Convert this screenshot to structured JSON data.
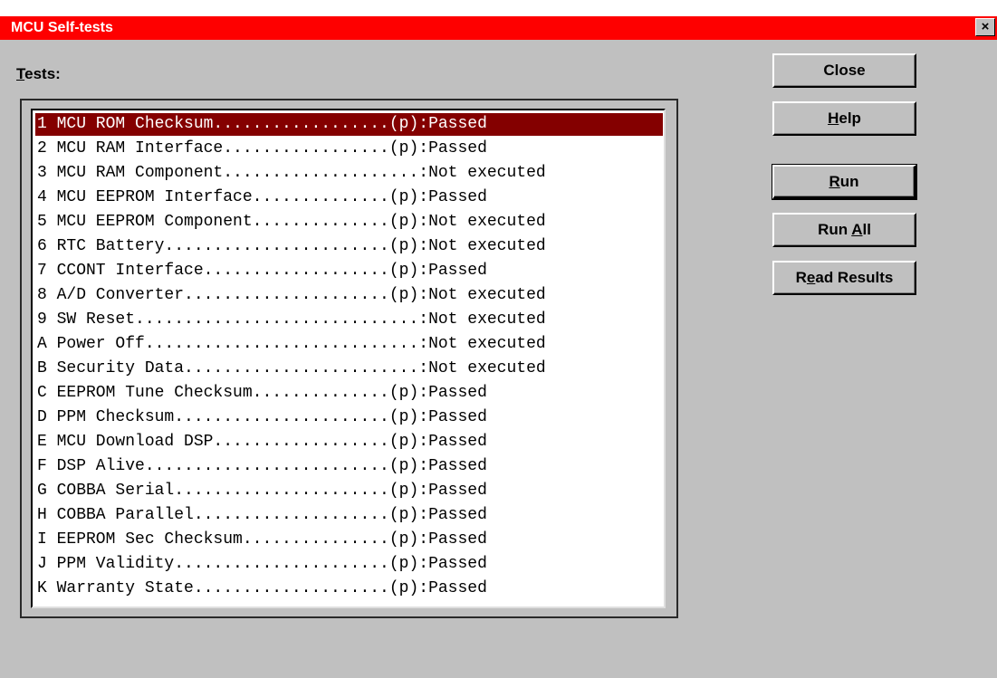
{
  "window": {
    "title": "MCU Self-tests",
    "close_glyph": "×",
    "titlebar_color": "#fe0000"
  },
  "tests_label": {
    "mnemonic": "T",
    "rest": "ests:"
  },
  "tests": [
    {
      "text": "1 MCU ROM Checksum..................(p):Passed",
      "selected": true
    },
    {
      "text": "2 MCU RAM Interface.................(p):Passed"
    },
    {
      "text": "3 MCU RAM Component....................:Not executed"
    },
    {
      "text": "4 MCU EEPROM Interface..............(p):Passed"
    },
    {
      "text": "5 MCU EEPROM Component..............(p):Not executed"
    },
    {
      "text": "6 RTC Battery.......................(p):Not executed"
    },
    {
      "text": "7 CCONT Interface...................(p):Passed"
    },
    {
      "text": "8 A/D Converter.....................(p):Not executed"
    },
    {
      "text": "9 SW Reset.............................:Not executed"
    },
    {
      "text": "A Power Off............................:Not executed"
    },
    {
      "text": "B Security Data........................:Not executed"
    },
    {
      "text": "C EEPROM Tune Checksum..............(p):Passed"
    },
    {
      "text": "D PPM Checksum......................(p):Passed"
    },
    {
      "text": "E MCU Download DSP..................(p):Passed"
    },
    {
      "text": "F DSP Alive.........................(p):Passed"
    },
    {
      "text": "G COBBA Serial......................(p):Passed"
    },
    {
      "text": "H COBBA Parallel....................(p):Passed"
    },
    {
      "text": "I EEPROM Sec Checksum...............(p):Passed"
    },
    {
      "text": "J PPM Validity......................(p):Passed"
    },
    {
      "text": "K Warranty State....................(p):Passed"
    }
  ],
  "buttons": {
    "close": {
      "label": "Close"
    },
    "help": {
      "pre": "",
      "mnemonic": "H",
      "post": "elp"
    },
    "run": {
      "pre": "",
      "mnemonic": "R",
      "post": "un"
    },
    "run_all": {
      "pre": "Run ",
      "mnemonic": "A",
      "post": "ll"
    },
    "read_results": {
      "pre": "R",
      "mnemonic": "e",
      "post": "ad Results"
    }
  },
  "colors": {
    "selection_bg": "#840000",
    "dialog_bg": "#c0c0c0"
  }
}
